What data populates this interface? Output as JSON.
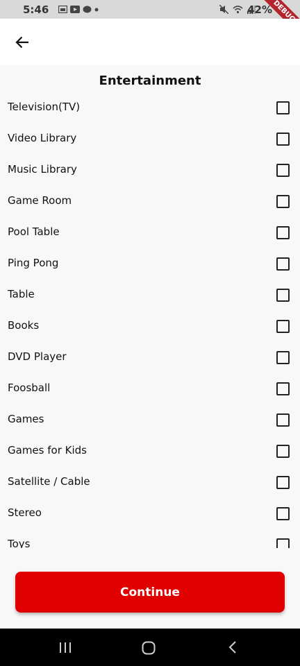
{
  "status_bar": {
    "time": "5:46",
    "battery": "42%",
    "debug_label": "DEBUG"
  },
  "page": {
    "title": "Entertainment"
  },
  "items": [
    {
      "label": "Television(TV)",
      "checked": false
    },
    {
      "label": "Video Library",
      "checked": false
    },
    {
      "label": "Music Library",
      "checked": false
    },
    {
      "label": "Game Room",
      "checked": false
    },
    {
      "label": "Pool Table",
      "checked": false
    },
    {
      "label": "Ping Pong",
      "checked": false
    },
    {
      "label": "Table",
      "checked": false
    },
    {
      "label": "Books",
      "checked": false
    },
    {
      "label": "DVD Player",
      "checked": false
    },
    {
      "label": "Foosball",
      "checked": false
    },
    {
      "label": "Games",
      "checked": false
    },
    {
      "label": "Games for Kids",
      "checked": false
    },
    {
      "label": "Satellite / Cable",
      "checked": false
    },
    {
      "label": "Stereo",
      "checked": false
    },
    {
      "label": "Toys",
      "checked": false
    }
  ],
  "continue_button": {
    "label": "Continue",
    "color": "#e00000"
  },
  "icons": {
    "back": "arrow-left-icon",
    "nav_recents": "recents-icon",
    "nav_home": "home-icon",
    "nav_back": "chevron-left-icon"
  }
}
